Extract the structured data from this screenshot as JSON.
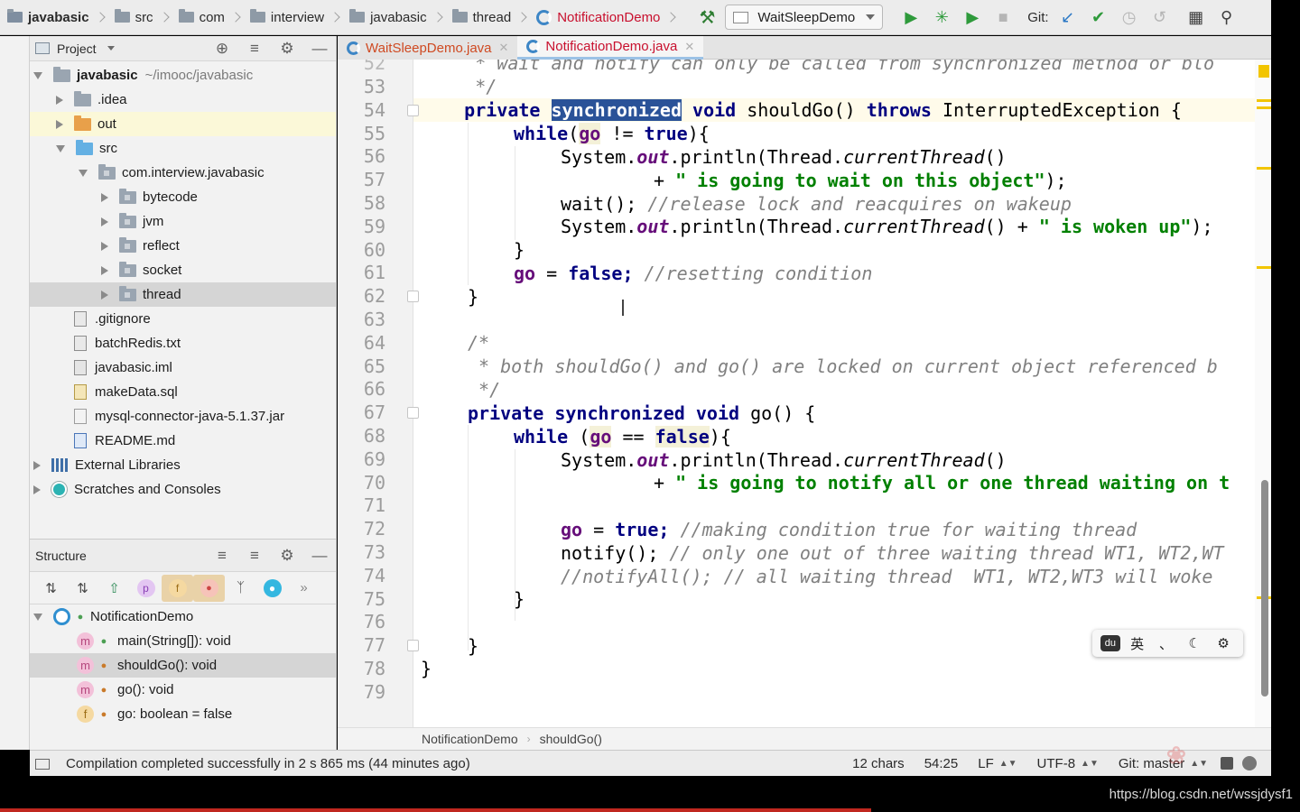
{
  "navbar": {
    "breadcrumbs": [
      {
        "label": "javabasic",
        "type": "project",
        "bold": true
      },
      {
        "label": "src",
        "type": "folder",
        "bold": false
      },
      {
        "label": "com",
        "type": "folder",
        "bold": false
      },
      {
        "label": "interview",
        "type": "folder",
        "bold": false
      },
      {
        "label": "javabasic",
        "type": "folder",
        "bold": false
      },
      {
        "label": "thread",
        "type": "folder",
        "bold": false
      },
      {
        "label": "NotificationDemo",
        "type": "class",
        "bold": false
      }
    ],
    "run_config": "WaitSleepDemo",
    "git_label": "Git:"
  },
  "project_panel": {
    "title": "Project",
    "tree": [
      {
        "label": "javabasic",
        "path": "~/imooc/javabasic",
        "icon": "project",
        "arrow": "down",
        "indent": 0,
        "bold": true
      },
      {
        "label": ".idea",
        "icon": "folder-gray",
        "arrow": "right",
        "indent": 1
      },
      {
        "label": "out",
        "icon": "folder-orange",
        "arrow": "right",
        "indent": 1,
        "highlight": true
      },
      {
        "label": "src",
        "icon": "folder-blue",
        "arrow": "down",
        "indent": 1
      },
      {
        "label": "com.interview.javabasic",
        "icon": "package",
        "arrow": "down",
        "indent": 2
      },
      {
        "label": "bytecode",
        "icon": "package",
        "arrow": "right",
        "indent": 3
      },
      {
        "label": "jvm",
        "icon": "package",
        "arrow": "right",
        "indent": 3
      },
      {
        "label": "reflect",
        "icon": "package",
        "arrow": "right",
        "indent": 3
      },
      {
        "label": "socket",
        "icon": "package",
        "arrow": "right",
        "indent": 3
      },
      {
        "label": "thread",
        "icon": "package",
        "arrow": "right",
        "indent": 3,
        "selected": true
      },
      {
        "label": ".gitignore",
        "icon": "file",
        "arrow": "none",
        "indent": 1
      },
      {
        "label": "batchRedis.txt",
        "icon": "file",
        "arrow": "none",
        "indent": 1
      },
      {
        "label": "javabasic.iml",
        "icon": "file-iml",
        "arrow": "none",
        "indent": 1
      },
      {
        "label": "makeData.sql",
        "icon": "file-sql",
        "arrow": "none",
        "indent": 1
      },
      {
        "label": "mysql-connector-java-5.1.37.jar",
        "icon": "file-jar",
        "arrow": "none",
        "indent": 1
      },
      {
        "label": "README.md",
        "icon": "file-md",
        "arrow": "none",
        "indent": 1
      },
      {
        "label": "External Libraries",
        "icon": "libraries",
        "arrow": "right",
        "indent": 0
      },
      {
        "label": "Scratches and Consoles",
        "icon": "scratches",
        "arrow": "right",
        "indent": 0
      }
    ]
  },
  "structure_panel": {
    "title": "Structure",
    "toolbar": [
      "sort-by-visibility",
      "sort-alphabetically",
      "show-inherited",
      "show-properties",
      "show-fields",
      "show-non-public",
      "show-lambdas",
      "autoscroll",
      "more"
    ],
    "class_name": "NotificationDemo",
    "members": [
      {
        "label": "main(String[]): void",
        "kind": "m",
        "access": "public",
        "selected": false
      },
      {
        "label": "shouldGo(): void",
        "kind": "m",
        "access": "private",
        "selected": true
      },
      {
        "label": "go(): void",
        "kind": "m",
        "access": "private",
        "selected": false
      },
      {
        "label": "go: boolean = false",
        "kind": "f",
        "access": "private",
        "selected": false
      }
    ]
  },
  "editor_tabs": [
    {
      "label": "WaitSleepDemo.java",
      "active": false
    },
    {
      "label": "NotificationDemo.java",
      "active": true
    }
  ],
  "editor": {
    "first_line_partial": "     * wait and notify can only be called from synchronized method or blo",
    "line_numbers": [
      "53",
      "54",
      "55",
      "56",
      "57",
      "58",
      "59",
      "60",
      "61",
      "62",
      "63",
      "64",
      "65",
      "66",
      "67",
      "68",
      "69",
      "70",
      "71",
      "72",
      "73",
      "74",
      "75",
      "76",
      "77",
      "78",
      "79"
    ],
    "current_line": "54",
    "selected_text": "synchronized",
    "code": {
      "l53": "     */",
      "l54_a": "    private ",
      "l54_sel": "synchronized",
      "l54_b": " void ",
      "l54_c": "shouldGo() ",
      "l54_d": "throws ",
      "l54_e": "InterruptedException {",
      "l55_kw": "while",
      "l55_a": "(",
      "l55_go": "go",
      "l55_b": " != ",
      "l55_true": "true",
      "l55_c": "){",
      "l56_a": "System.",
      "l56_out": "out",
      "l56_b": ".println(Thread.",
      "l56_ct": "currentThread",
      "l56_c": "()",
      "l57_a": "+ ",
      "l57_str": "\" is going to wait on this object\"",
      "l57_b": ");",
      "l58_a": "wait(); ",
      "l58_cmt": "//release lock and reacquires on wakeup",
      "l59_a": "System.",
      "l59_out": "out",
      "l59_b": ".println(Thread.",
      "l59_ct": "currentThread",
      "l59_c": "() + ",
      "l59_str": "\" is woken up\"",
      "l59_d": ");",
      "l60": "}",
      "l61_go": "go",
      "l61_a": " = ",
      "l61_false": "false",
      "l61_b": "; ",
      "l61_cmt": "//resetting condition",
      "l62": "}",
      "l64": "/*",
      "l65": " * both shouldGo() and go() are locked on current object referenced b",
      "l66": " */",
      "l67_a": "private synchronized void ",
      "l67_b": "go() {",
      "l68_kw": "while",
      "l68_a": " (",
      "l68_go": "go",
      "l68_b": " == ",
      "l68_false": "false",
      "l68_c": "){",
      "l69_a": "System.",
      "l69_out": "out",
      "l69_b": ".println(Thread.",
      "l69_ct": "currentThread",
      "l69_c": "()",
      "l70_a": "+ ",
      "l70_str": "\" is going to notify all or one thread waiting on t",
      "l72_go": "go",
      "l72_a": " = ",
      "l72_true": "true",
      "l72_b": "; ",
      "l72_cmt": "//making condition true for waiting thread",
      "l73_a": "notify(); ",
      "l73_cmt": "// only one out of three waiting thread WT1, WT2,WT",
      "l74_cmt": "//notifyAll(); // all waiting thread  WT1, WT2,WT3 will woke",
      "l75": "}",
      "l77": "}",
      "l78": "}"
    }
  },
  "ime": {
    "items": [
      "du",
      "英",
      "、",
      "moon",
      "gear"
    ]
  },
  "breadcrumb": {
    "class": "NotificationDemo",
    "method": "shouldGo()"
  },
  "status": {
    "message": "Compilation completed successfully in 2 s 865 ms (44 minutes ago)",
    "chars": "12 chars",
    "position": "54:25",
    "line_sep": "LF",
    "encoding": "UTF-8",
    "git": "Git: master"
  },
  "footer": {
    "url": "https://blog.csdn.net/wssjdysf1"
  },
  "colors": {
    "keyword": "#000080",
    "string": "#008000",
    "field": "#660e7a",
    "comment": "#808080",
    "selection": "#2a5298",
    "current_line": "#fffbea"
  }
}
